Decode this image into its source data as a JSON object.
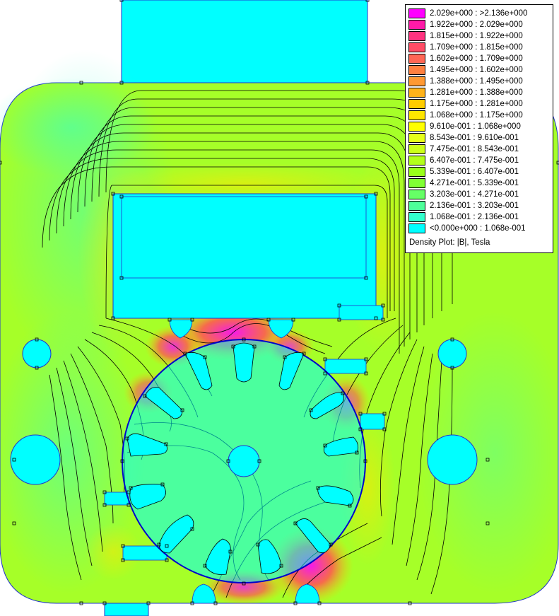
{
  "legend": {
    "title": "Density Plot: |B|, Tesla",
    "entries": [
      {
        "label": "2.029e+000 : >2.136e+000",
        "color": "#ff00ff"
      },
      {
        "label": "1.922e+000 : 2.029e+000",
        "color": "#ff1aa8"
      },
      {
        "label": "1.815e+000 : 1.922e+000",
        "color": "#ff3380"
      },
      {
        "label": "1.709e+000 : 1.815e+000",
        "color": "#ff4d66"
      },
      {
        "label": "1.602e+000 : 1.709e+000",
        "color": "#ff6655"
      },
      {
        "label": "1.495e+000 : 1.602e+000",
        "color": "#ff8040"
      },
      {
        "label": "1.388e+000 : 1.495e+000",
        "color": "#ff9933"
      },
      {
        "label": "1.281e+000 : 1.388e+000",
        "color": "#ffb31a"
      },
      {
        "label": "1.175e+000 : 1.281e+000",
        "color": "#ffcc00"
      },
      {
        "label": "1.068e+000 : 1.175e+000",
        "color": "#ffe600"
      },
      {
        "label": "9.610e-001 : 1.068e+000",
        "color": "#ffff00"
      },
      {
        "label": "8.543e-001 : 9.610e-001",
        "color": "#e6ff1a"
      },
      {
        "label": "7.475e-001 : 8.543e-001",
        "color": "#ccff1a"
      },
      {
        "label": "6.407e-001 : 7.475e-001",
        "color": "#b3ff1a"
      },
      {
        "label": "5.339e-001 : 6.407e-001",
        "color": "#99ff1a"
      },
      {
        "label": "4.271e-001 : 5.339e-001",
        "color": "#80ff33"
      },
      {
        "label": "3.203e-001 : 4.271e-001",
        "color": "#66ff66"
      },
      {
        "label": "2.136e-001 : 3.203e-001",
        "color": "#4dff99"
      },
      {
        "label": "1.068e-001 : 2.136e-001",
        "color": "#33ffcc"
      },
      {
        "label": "<0.000e+000 : 1.068e-001",
        "color": "#00ffff"
      }
    ]
  },
  "colors": {
    "air": "#00ffff",
    "iron_base": "#a6ff28",
    "iron_high": "#ffe600",
    "saturation": "#ff33aa",
    "contour": "#000000",
    "rotor_boundary": "#0000cc",
    "geometry_outline": "#2233cc"
  }
}
